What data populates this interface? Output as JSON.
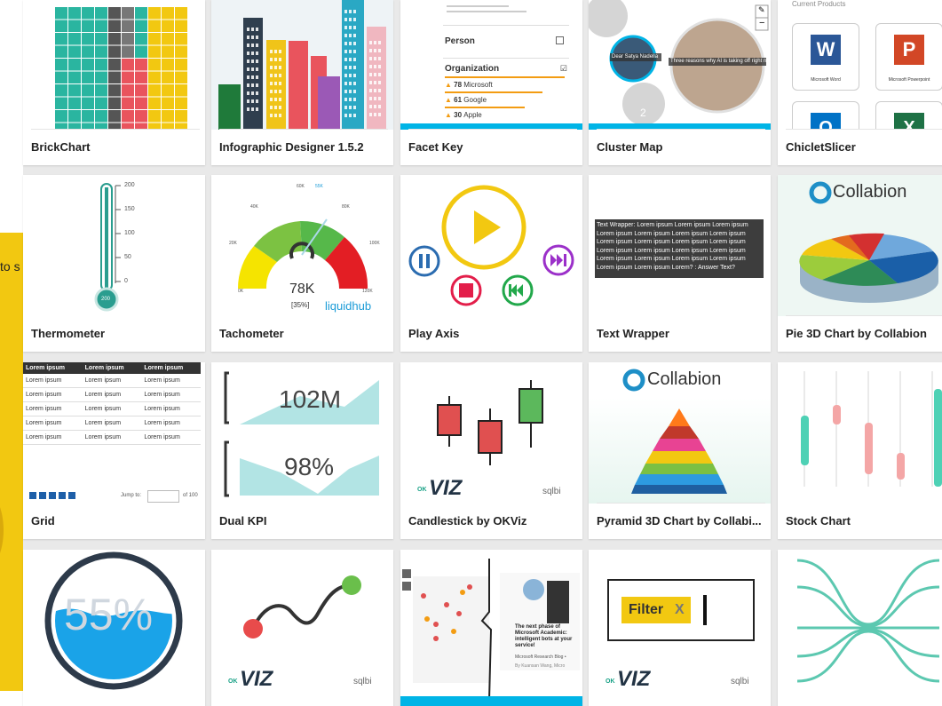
{
  "side_panel": {
    "peek_text": "to s"
  },
  "cards": {
    "brickchart": {
      "label": "BrickChart"
    },
    "infographic": {
      "label": "Infographic Designer 1.5.2"
    },
    "facetkey": {
      "label": "Facet Key",
      "person": "Person",
      "organization": "Organization",
      "orgs": [
        {
          "count": "78",
          "name": "Microsoft"
        },
        {
          "count": "61",
          "name": "Google"
        },
        {
          "count": "30",
          "name": "Apple"
        }
      ]
    },
    "clustermap": {
      "label": "Cluster Map",
      "bubble1": "Dear Satya Nadella",
      "bubble2": "Three reasons why AI is taking off right no",
      "badge": "2"
    },
    "chicletslicer": {
      "label": "ChicletSlicer",
      "header": "Current Products",
      "items": [
        "Microsoft Word",
        "Microsoft Powerpoint"
      ]
    },
    "thermometer": {
      "label": "Thermometer",
      "ticks": [
        "200",
        "150",
        "100",
        "50",
        "0"
      ],
      "bulb": "200"
    },
    "tachometer": {
      "label": "Tachometer",
      "value": "78K",
      "percent": "[35%]",
      "brand": "liquidhub",
      "scale": [
        "0K",
        "20K",
        "40K",
        "60K",
        "80K",
        "100K",
        "120K"
      ],
      "target": "55K"
    },
    "playaxis": {
      "label": "Play Axis"
    },
    "textwrapper": {
      "label": "Text Wrapper",
      "text": "Text Wrapper: Lorem ipsum Lorem ipsum Lorem ipsum Lorem ipsum Lorem ipsum Lorem ipsum Lorem ipsum Lorem ipsum Lorem ipsum Lorem ipsum Lorem ipsum Lorem ipsum Lorem ipsum Lorem ipsum Lorem ipsum Lorem ipsum Lorem ipsum Lorem ipsum Lorem ipsum Lorem ipsum Lorem ipsum Lorem? : Answer Text?"
    },
    "pie3d": {
      "label": "Pie 3D Chart by Collabion",
      "brand": "Collabion"
    },
    "grid": {
      "label": "Grid",
      "headers": [
        "Lorem ipsum",
        "Lorem ipsum",
        "Lorem ipsum"
      ],
      "cell": "Lorem ipsum",
      "jump": "Jump to:",
      "of": "of 100"
    },
    "dualkpi": {
      "label": "Dual KPI",
      "kpi1": "102M",
      "kpi2": "98%"
    },
    "candlestick": {
      "label": "Candlestick by OKViz",
      "brand": "VIZ",
      "ok": "OK",
      "sqlbi": "sqlbi"
    },
    "pyramid3d": {
      "label": "Pyramid 3D Chart by Collabi...",
      "brand": "Collabion"
    },
    "stockchart": {
      "label": "Stock Chart"
    },
    "liquidfill": {
      "value": "55%"
    },
    "okvizline": {
      "brand": "VIZ",
      "ok": "OK",
      "sqlbi": "sqlbi"
    },
    "academic": {
      "headline": "The next phase of Microsoft Academic: intelligent bots at your service!",
      "source": "Microsoft Research Blog •",
      "author": "By Kuansan Wang, Micro"
    },
    "filter": {
      "filter_label": "Filter",
      "x": "X",
      "brand": "VIZ",
      "ok": "OK",
      "sqlbi": "sqlbi"
    },
    "sankey": {}
  },
  "colors": {
    "accent_blue": "#00b4e6",
    "yellow": "#f2c811"
  }
}
